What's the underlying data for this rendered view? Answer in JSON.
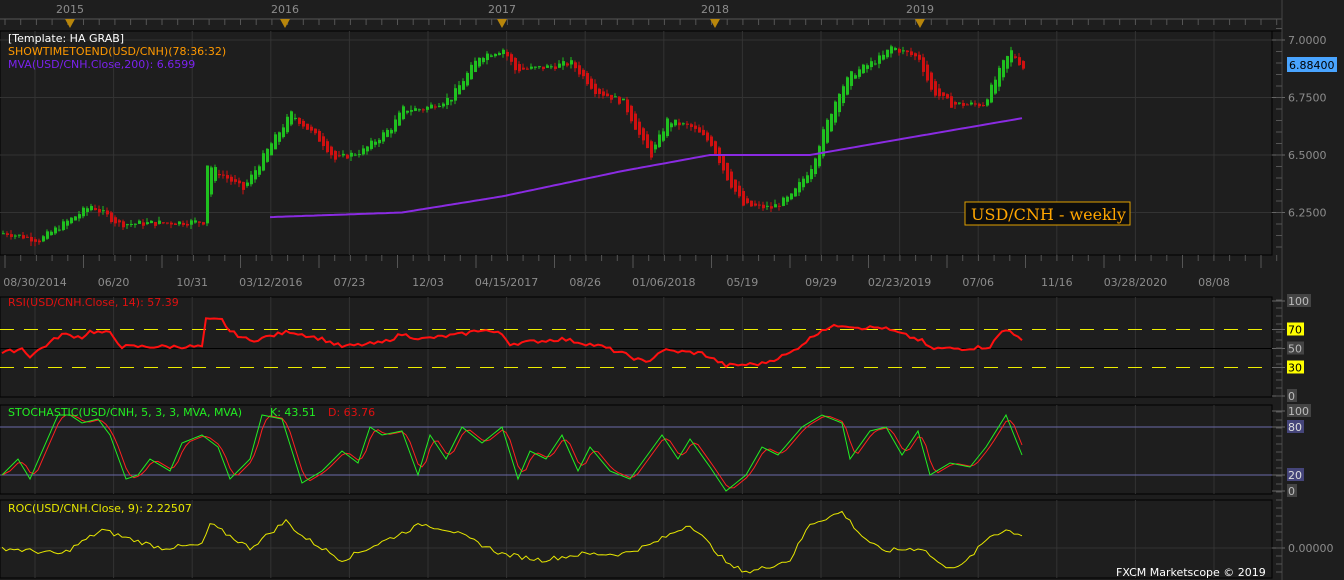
{
  "colors": {
    "bg": "#1e1e1e",
    "up": "#1fc01f",
    "down": "#d01010",
    "mva": "#8a2be2",
    "rsi": "#ff1010",
    "stochK": "#22ee22",
    "stochD": "#ff2020",
    "roc": "#e8e800",
    "accent": "#ffa500",
    "price_badge": "#49a4ff"
  },
  "legend": {
    "template": "[Template: HA GRAB]",
    "timer": "SHOWTIMETOEND(USD/CNH)(78:36:32)",
    "mva": "MVA(USD/CNH.Close,200): 6.6599"
  },
  "symbol_label": "USD/CNH - weekly",
  "current_price": "6.88400",
  "year_markers": [
    "2015",
    "2016",
    "2017",
    "2018",
    "2019"
  ],
  "date_ticks": [
    "08/30/2014",
    "06/20",
    "10/31",
    "03/12/2016",
    "07/23",
    "12/03",
    "04/15/2017",
    "08/26",
    "01/06/2018",
    "05/19",
    "09/29",
    "02/23/2019",
    "07/06",
    "11/16",
    "03/28/2020",
    "08/08"
  ],
  "price_ticks": [
    "7.0000",
    "6.7500",
    "6.5000",
    "6.2500"
  ],
  "rsi": {
    "title": "RSI(USD/CNH.Close, 14): 57.39",
    "ticks": [
      "100",
      "70",
      "50",
      "30",
      "0"
    ]
  },
  "stochastic": {
    "title": "STOCHASTIC(USD/CNH, 5, 3, 3, MVA, MVA)",
    "k": "K: 43.51",
    "d": "D: 63.76",
    "ticks": [
      "100",
      "80",
      "20",
      "0"
    ]
  },
  "roc": {
    "title": "ROC(USD/CNH.Close, 9): 2.22507",
    "ticks": [
      "0.00000"
    ]
  },
  "footer": "FXCM Marketscope © 2019",
  "chart_data": {
    "type": "candlestick",
    "title": "USD/CNH - weekly",
    "ylim": [
      6.08,
      7.08
    ],
    "price_keypoints": [
      [
        1,
        6.16
      ],
      [
        9,
        6.13
      ],
      [
        15,
        6.2
      ],
      [
        22,
        6.28
      ],
      [
        29,
        6.2
      ],
      [
        50,
        6.21
      ],
      [
        51,
        6.46
      ],
      [
        60,
        6.35
      ],
      [
        67,
        6.55
      ],
      [
        72,
        6.68
      ],
      [
        80,
        6.55
      ],
      [
        83,
        6.48
      ],
      [
        90,
        6.52
      ],
      [
        97,
        6.62
      ],
      [
        100,
        6.7
      ],
      [
        105,
        6.7
      ],
      [
        112,
        6.75
      ],
      [
        119,
        6.93
      ],
      [
        125,
        6.96
      ],
      [
        128,
        6.87
      ],
      [
        135,
        6.88
      ],
      [
        142,
        6.9
      ],
      [
        148,
        6.78
      ],
      [
        155,
        6.73
      ],
      [
        160,
        6.55
      ],
      [
        162,
        6.5
      ],
      [
        166,
        6.65
      ],
      [
        172,
        6.62
      ],
      [
        177,
        6.55
      ],
      [
        181,
        6.4
      ],
      [
        185,
        6.28
      ],
      [
        192,
        6.27
      ],
      [
        197,
        6.32
      ],
      [
        202,
        6.45
      ],
      [
        205,
        6.6
      ],
      [
        209,
        6.78
      ],
      [
        212,
        6.85
      ],
      [
        220,
        6.93
      ],
      [
        222,
        6.97
      ],
      [
        229,
        6.92
      ],
      [
        232,
        6.78
      ],
      [
        237,
        6.72
      ],
      [
        245,
        6.72
      ],
      [
        250,
        6.9
      ],
      [
        252,
        6.95
      ],
      [
        255,
        6.88
      ]
    ],
    "mva_keypoints": [
      [
        67,
        6.23
      ],
      [
        100,
        6.25
      ],
      [
        125,
        6.32
      ],
      [
        155,
        6.43
      ],
      [
        177,
        6.5
      ],
      [
        202,
        6.5
      ],
      [
        225,
        6.57
      ],
      [
        255,
        6.66
      ]
    ],
    "rsi_keypoints": [
      [
        0,
        45
      ],
      [
        5,
        50
      ],
      [
        7,
        42
      ],
      [
        15,
        65
      ],
      [
        20,
        62
      ],
      [
        22,
        68
      ],
      [
        27,
        66
      ],
      [
        30,
        52
      ],
      [
        50,
        52
      ],
      [
        51,
        80
      ],
      [
        55,
        80
      ],
      [
        57,
        68
      ],
      [
        62,
        58
      ],
      [
        72,
        68
      ],
      [
        80,
        60
      ],
      [
        85,
        52
      ],
      [
        95,
        56
      ],
      [
        100,
        65
      ],
      [
        105,
        60
      ],
      [
        115,
        65
      ],
      [
        120,
        70
      ],
      [
        125,
        65
      ],
      [
        127,
        55
      ],
      [
        140,
        60
      ],
      [
        150,
        52
      ],
      [
        155,
        45
      ],
      [
        161,
        35
      ],
      [
        165,
        48
      ],
      [
        175,
        45
      ],
      [
        181,
        32
      ],
      [
        190,
        34
      ],
      [
        197,
        45
      ],
      [
        205,
        70
      ],
      [
        210,
        75
      ],
      [
        215,
        72
      ],
      [
        220,
        72
      ],
      [
        225,
        65
      ],
      [
        230,
        58
      ],
      [
        232,
        50
      ],
      [
        240,
        50
      ],
      [
        247,
        52
      ],
      [
        250,
        68
      ],
      [
        252,
        70
      ],
      [
        255,
        57
      ]
    ],
    "stoch_k_keypoints": [
      [
        0,
        20
      ],
      [
        4,
        40
      ],
      [
        7,
        15
      ],
      [
        14,
        95
      ],
      [
        17,
        95
      ],
      [
        20,
        85
      ],
      [
        24,
        90
      ],
      [
        27,
        70
      ],
      [
        31,
        15
      ],
      [
        34,
        20
      ],
      [
        37,
        40
      ],
      [
        42,
        25
      ],
      [
        45,
        60
      ],
      [
        50,
        70
      ],
      [
        54,
        55
      ],
      [
        57,
        15
      ],
      [
        62,
        40
      ],
      [
        65,
        95
      ],
      [
        70,
        90
      ],
      [
        75,
        10
      ],
      [
        80,
        25
      ],
      [
        85,
        50
      ],
      [
        89,
        35
      ],
      [
        92,
        80
      ],
      [
        95,
        70
      ],
      [
        100,
        75
      ],
      [
        104,
        20
      ],
      [
        107,
        70
      ],
      [
        111,
        40
      ],
      [
        115,
        80
      ],
      [
        120,
        60
      ],
      [
        125,
        80
      ],
      [
        129,
        15
      ],
      [
        132,
        50
      ],
      [
        136,
        40
      ],
      [
        140,
        70
      ],
      [
        144,
        25
      ],
      [
        147,
        55
      ],
      [
        152,
        25
      ],
      [
        157,
        15
      ],
      [
        165,
        70
      ],
      [
        169,
        40
      ],
      [
        172,
        65
      ],
      [
        177,
        30
      ],
      [
        181,
        0
      ],
      [
        186,
        20
      ],
      [
        190,
        55
      ],
      [
        194,
        45
      ],
      [
        200,
        80
      ],
      [
        205,
        95
      ],
      [
        210,
        85
      ],
      [
        212,
        40
      ],
      [
        217,
        75
      ],
      [
        221,
        80
      ],
      [
        225,
        45
      ],
      [
        229,
        75
      ],
      [
        232,
        20
      ],
      [
        237,
        35
      ],
      [
        242,
        30
      ],
      [
        246,
        55
      ],
      [
        251,
        95
      ],
      [
        255,
        45
      ]
    ],
    "roc_keypoints": [
      [
        0,
        0
      ],
      [
        15,
        -1
      ],
      [
        25,
        3
      ],
      [
        32,
        1.5
      ],
      [
        40,
        0
      ],
      [
        50,
        0.5
      ],
      [
        52,
        4
      ],
      [
        57,
        2
      ],
      [
        62,
        0
      ],
      [
        71,
        4.5
      ],
      [
        75,
        2
      ],
      [
        85,
        -2
      ],
      [
        95,
        1
      ],
      [
        105,
        4
      ],
      [
        112,
        3
      ],
      [
        125,
        -1
      ],
      [
        135,
        -2
      ],
      [
        145,
        -1
      ],
      [
        155,
        -1
      ],
      [
        162,
        0.5
      ],
      [
        172,
        4
      ],
      [
        182,
        -3
      ],
      [
        187,
        -4
      ],
      [
        197,
        -2
      ],
      [
        202,
        4
      ],
      [
        210,
        6
      ],
      [
        215,
        2
      ],
      [
        220,
        -0.5
      ],
      [
        230,
        0
      ],
      [
        235,
        -3
      ],
      [
        240,
        -3
      ],
      [
        247,
        2
      ],
      [
        251,
        3
      ],
      [
        255,
        2.22
      ]
    ],
    "rsi_levels": [
      70,
      50,
      30
    ],
    "stoch_levels": [
      80,
      20
    ]
  }
}
